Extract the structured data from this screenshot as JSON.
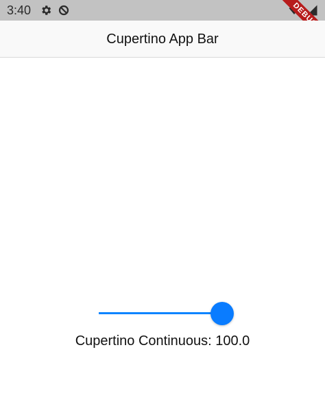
{
  "status_bar": {
    "time": "3:40",
    "icons": [
      "gear-icon",
      "sync-disabled-icon",
      "wifi-icon",
      "signal-icon"
    ]
  },
  "app_bar": {
    "title": "Cupertino App Bar"
  },
  "slider": {
    "value": 100.0,
    "min": 0,
    "max": 100,
    "active_color": "#0a84ff",
    "label": "Cupertino Continuous: 100.0"
  },
  "debug_banner": {
    "label": "DEBUG",
    "color": "#b71c1c"
  }
}
